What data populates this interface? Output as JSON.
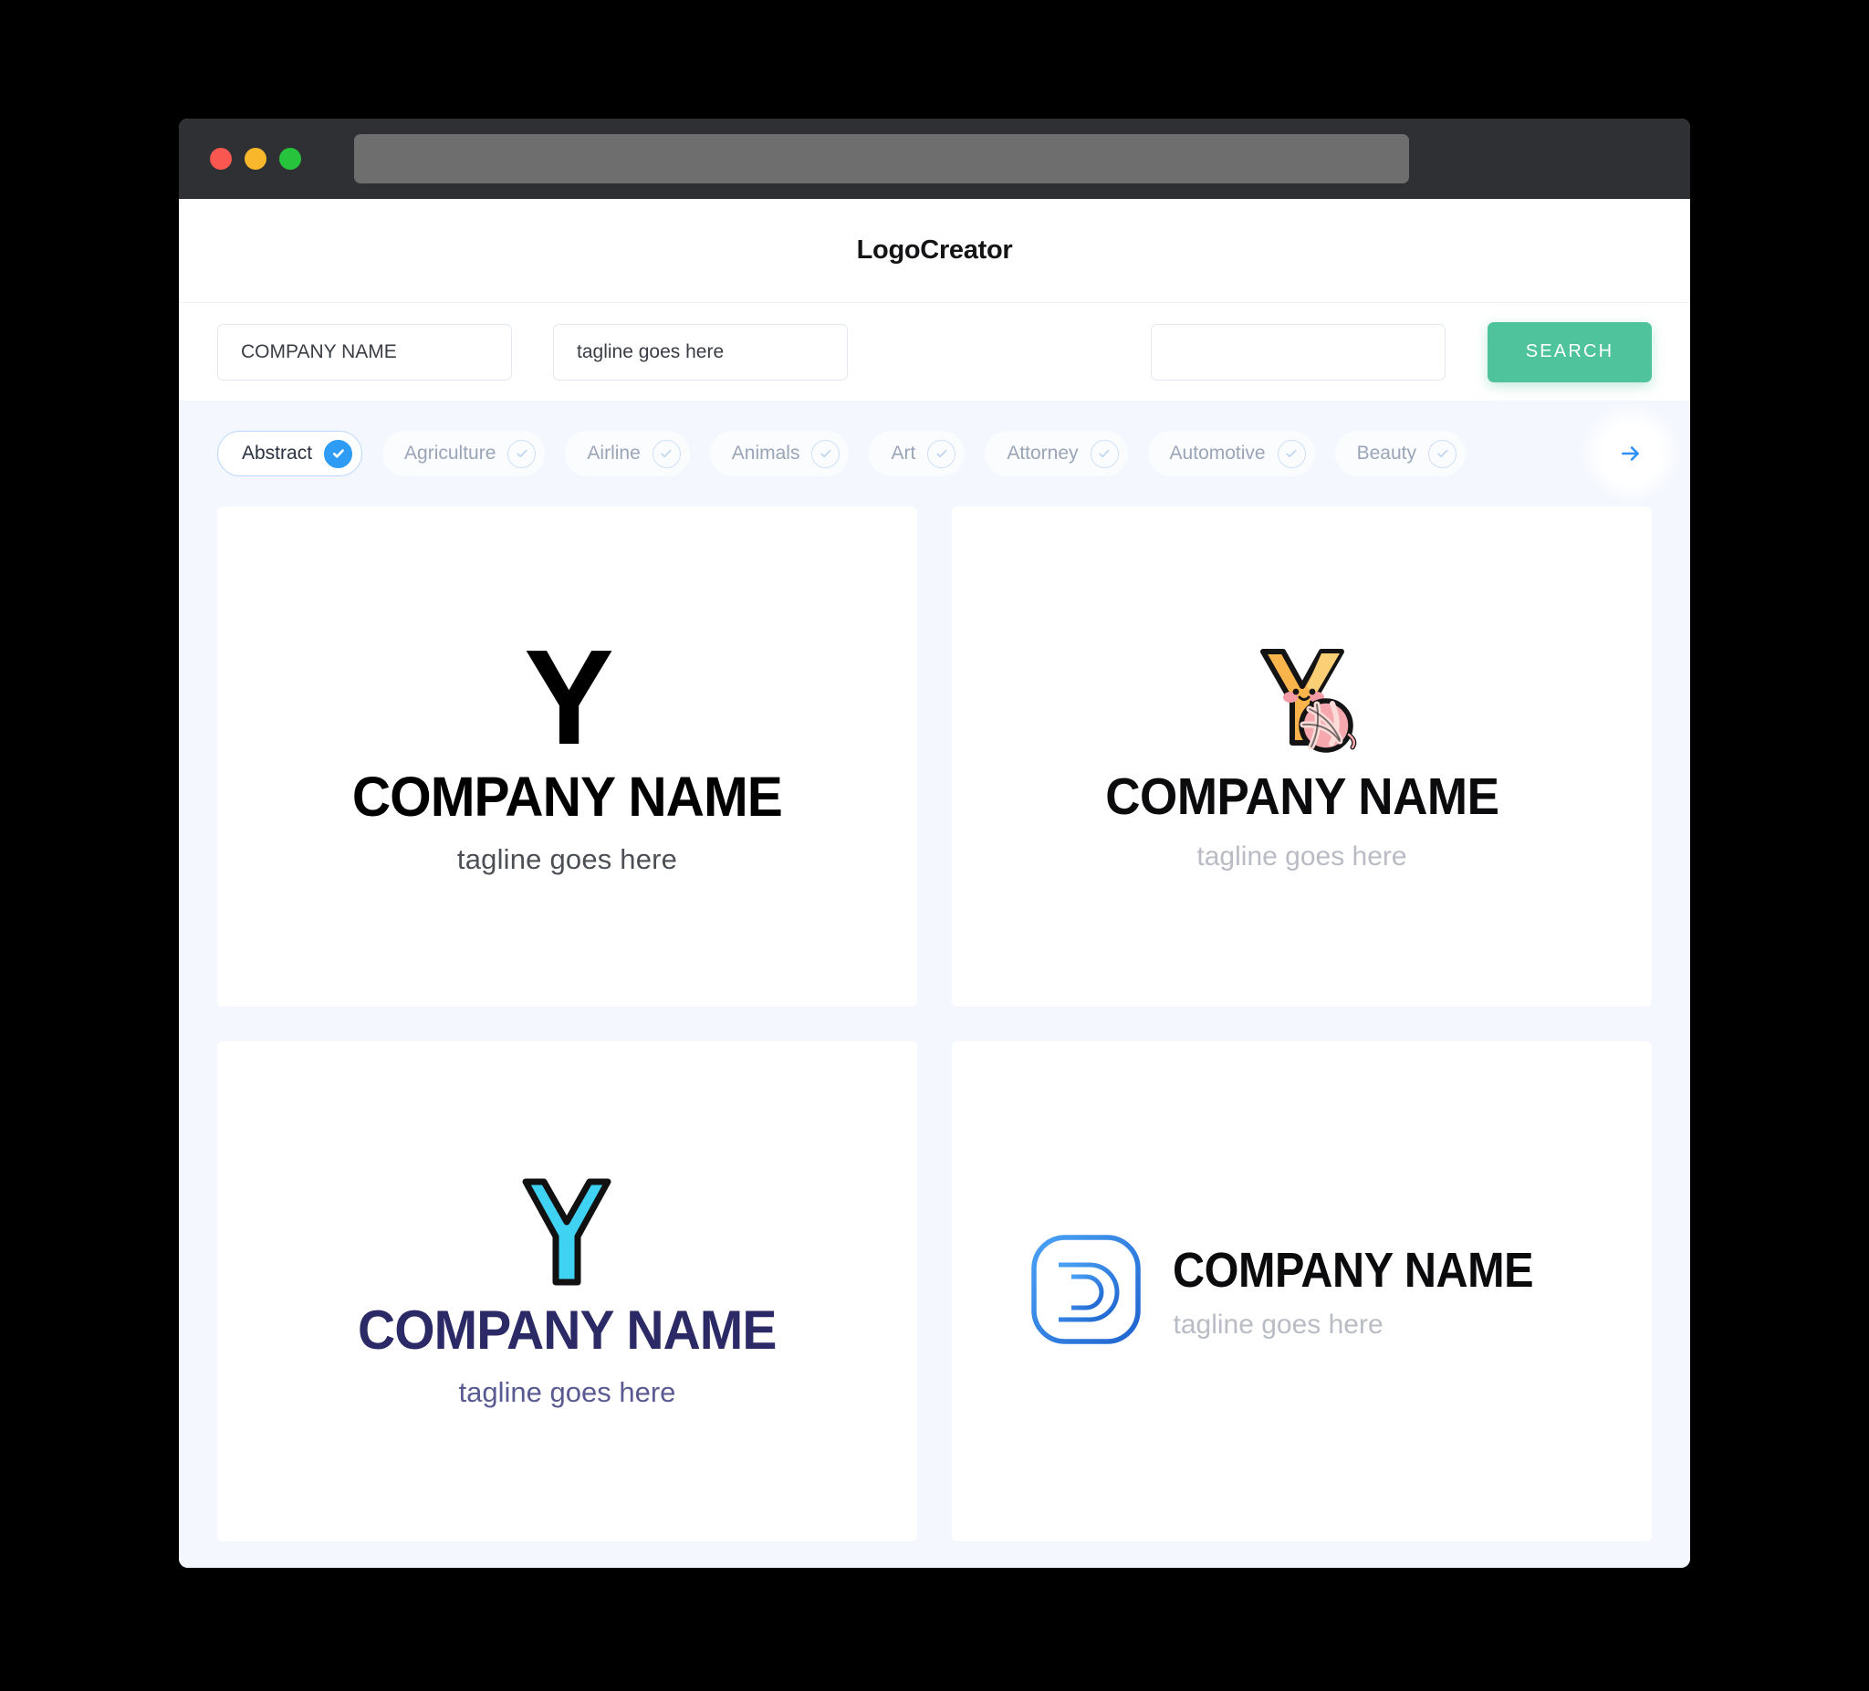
{
  "window": {
    "traffic_lights": [
      "close-red",
      "minimize-yellow",
      "maximize-green"
    ],
    "url_value": ""
  },
  "header": {
    "title": "LogoCreator"
  },
  "search": {
    "company_value": "COMPANY NAME",
    "company_placeholder": "COMPANY NAME",
    "tagline_value": "tagline goes here",
    "tagline_placeholder": "tagline goes here",
    "extra_value": "",
    "extra_placeholder": "",
    "button_label": "SEARCH",
    "button_color": "#4fc49c"
  },
  "filters": {
    "accent_color": "#2e9bf5",
    "next_icon": "arrow-right-icon",
    "chips": [
      {
        "label": "Abstract",
        "selected": true
      },
      {
        "label": "Agriculture",
        "selected": false
      },
      {
        "label": "Airline",
        "selected": false
      },
      {
        "label": "Animals",
        "selected": false
      },
      {
        "label": "Art",
        "selected": false
      },
      {
        "label": "Attorney",
        "selected": false
      },
      {
        "label": "Automotive",
        "selected": false
      },
      {
        "label": "Beauty",
        "selected": false
      }
    ]
  },
  "results": {
    "cards": [
      {
        "id": "logo-card-1",
        "mark_letter": "Y",
        "mark_style": "bold-black-letter",
        "company_name": "COMPANY NAME",
        "tagline": "tagline goes here",
        "name_color": "#000000",
        "tagline_color": "#4c4f55",
        "mark_color": "#000000"
      },
      {
        "id": "logo-card-2",
        "mark_letter": "Y",
        "mark_style": "kawaii-yarn-character",
        "company_name": "COMPANY NAME",
        "tagline": "tagline goes here",
        "name_color": "#0b0b0d",
        "tagline_color": "#b9bcc4",
        "mark_color": "#f8b councils"
      },
      {
        "id": "logo-card-3",
        "mark_letter": "Y",
        "mark_style": "cyan-outlined-letter",
        "company_name": "COMPANY NAME",
        "tagline": "tagline goes here",
        "name_color": "#2b2a66",
        "tagline_color": "#5a5a93",
        "mark_color": "#3fd2f2"
      },
      {
        "id": "logo-card-4",
        "mark_letter": "D",
        "mark_style": "blue-rounded-square-monogram",
        "company_name": "COMPANY NAME",
        "tagline": "tagline goes here",
        "name_color": "#0b0b0d",
        "tagline_color": "#b9bcc4",
        "mark_color": "#2f80ed"
      }
    ]
  }
}
